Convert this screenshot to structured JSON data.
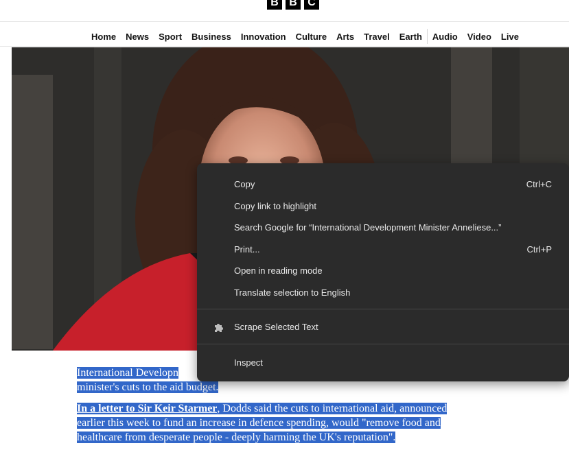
{
  "logo": {
    "letters": [
      "B",
      "B",
      "C"
    ]
  },
  "nav": {
    "items": [
      "Home",
      "News",
      "Sport",
      "Business",
      "Innovation",
      "Culture",
      "Arts",
      "Travel",
      "Earth",
      "Audio",
      "Video",
      "Live"
    ]
  },
  "article": {
    "p1_line1": "International Developn",
    "p1_line2": "minister's cuts to the aid budget.",
    "p2_link": "In a letter to Sir Keir Starmer",
    "p2_rest1": ", Dodds said the cuts to international aid, announced",
    "p2_line2": "earlier this week to fund an increase in defence spending, would \"remove food and",
    "p2_line3": "healthcare from desperate people - deeply harming the UK's reputation\"."
  },
  "context_menu": {
    "copy": "Copy",
    "copy_shortcut": "Ctrl+C",
    "copy_link": "Copy link to highlight",
    "search_google": "Search Google for “International Development Minister Anneliese...”",
    "print": "Print...",
    "print_shortcut": "Ctrl+P",
    "reading_mode": "Open in reading mode",
    "translate": "Translate selection to English",
    "scrape": "Scrape Selected Text",
    "inspect": "Inspect"
  },
  "colors": {
    "selection": "#3267c9",
    "menu_bg": "#2b2b2b"
  }
}
